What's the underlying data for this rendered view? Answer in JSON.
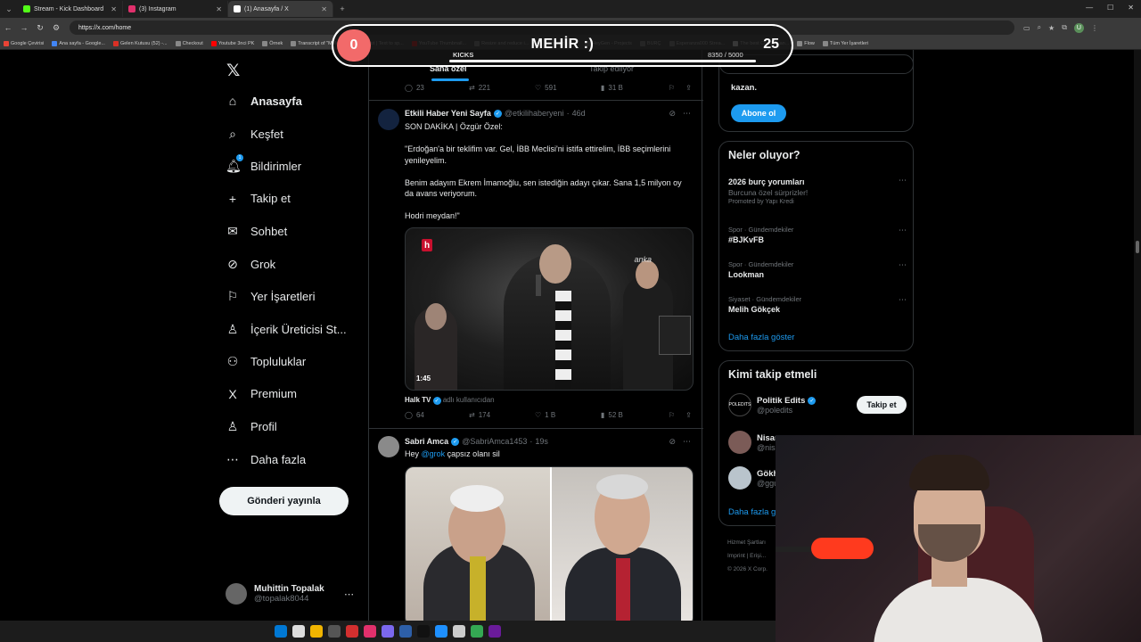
{
  "browser": {
    "tabs": [
      {
        "title": "Stream - Kick Dashboard",
        "color": "#53fc18"
      },
      {
        "title": "(3) Instagram",
        "color": "#e1306c"
      },
      {
        "title": "(1) Anasayfa / X",
        "color": "#ffffff"
      }
    ],
    "url": "https://x.com/home",
    "bookmarks": [
      "Google Çevirisi",
      "Ana sayfa - Google...",
      "Gelen Kutusu (52) -...",
      "Checkout",
      "Youtube 3nci PK",
      "Örnek",
      "Transcript of \"Mi M...",
      "CapCut | Text to sp...",
      "YouTube Thumbnail...",
      "Resize and reduce i...",
      "İspanyolca Ö...",
      "HeyGen - Projects",
      "BURÇ",
      "Esperanza000 Strea...",
      "The best ChatBot an...",
      "Flow",
      "Tüm Yer İşaretleri"
    ],
    "profile_initial": "U"
  },
  "overlay": {
    "left_value": "0",
    "title": "MEHİR :)",
    "right_value": "25",
    "kicks_label": "KICKS",
    "kicks_count": "8350",
    "kicks_goal": "/ 5000",
    "progress": 1.0
  },
  "nav": {
    "items": [
      {
        "label": "Anasayfa",
        "icon": "⌂"
      },
      {
        "label": "Keşfet",
        "icon": "⌕"
      },
      {
        "label": "Bildirimler",
        "icon": "🔔︎",
        "badge": "1"
      },
      {
        "label": "Takip et",
        "icon": "+"
      },
      {
        "label": "Sohbet",
        "icon": "✉"
      },
      {
        "label": "Grok",
        "icon": "⊘"
      },
      {
        "label": "Yer İşaretleri",
        "icon": "⚐"
      },
      {
        "label": "İçerik Üreticisi St...",
        "icon": "♙"
      },
      {
        "label": "Topluluklar",
        "icon": "⚇"
      },
      {
        "label": "Premium",
        "icon": "X"
      },
      {
        "label": "Profil",
        "icon": "♙"
      },
      {
        "label": "Daha fazla",
        "icon": "⋯"
      }
    ],
    "post_button": "Gönderi yayınla",
    "account_name": "Muhittin Topalak",
    "account_handle": "@topalak8044"
  },
  "feed": {
    "tab_foryou": "Sana özel",
    "tab_following": "Takip edilyor",
    "prev_actions": {
      "reply": "23",
      "repost": "221",
      "like": "591",
      "views": "31 B"
    },
    "tweet1": {
      "name": "Etkili Haber Yeni Sayfa",
      "handle": "@etkilihaberyeni",
      "time": "46d",
      "line1": "SON DAKİKA | Özgür Özel:",
      "line2": "\"Erdoğan'a bir teklifim var. Gel, İBB Meclisi'ni istifa ettirelim, İBB seçimlerini yenileyelim.",
      "line3": "Benim adayım Ekrem İmamoğlu, sen istediğin adayı çıkar. Sana 1,5 milyon oy da avans veriyorum.",
      "line4": "Hodri meydan!\"",
      "video_time": "1:45",
      "video_brand": "anka",
      "source_name": "Halk TV",
      "source_text": "adlı kullanıcıdan",
      "actions": {
        "reply": "64",
        "repost": "174",
        "like": "1 B",
        "views": "52 B"
      }
    },
    "tweet2": {
      "name": "Sabri Amca",
      "handle": "@SabriAmca1453",
      "time": "19s",
      "text_prefix": "Hey ",
      "mention": "@grok",
      "text_suffix": " çapsız olanı sil"
    }
  },
  "sidebar": {
    "subscribe_text": "kazan.",
    "subscribe_button": "Abone ol",
    "trends_title": "Neler oluyor?",
    "trends": [
      {
        "context": "",
        "title": "2026 burç yorumları",
        "sub": "Burcuna özel sürprizler!",
        "promo": "Promoted by Yapı Kredi"
      },
      {
        "context": "Spor · Gündemdekiler",
        "title": "#BJKvFB"
      },
      {
        "context": "Spor · Gündemdekiler",
        "title": "Lookman"
      },
      {
        "context": "Siyaset · Gündemdekiler",
        "title": "Melih Gökçek"
      }
    ],
    "show_more": "Daha fazla göster",
    "who_title": "Kimi takip etmeli",
    "who": [
      {
        "name": "Politik Edits",
        "handle": "@poledits",
        "button": "Takip et"
      },
      {
        "name": "Nisan",
        "handle": "@nisa..."
      },
      {
        "name": "Gökh...",
        "handle": "@ggu..."
      }
    ],
    "who_more": "Daha fazla g...",
    "footer1": "Hizmet Şartları",
    "footer2": "Imprint  |  Erişi...",
    "footer3": "© 2026 X Corp."
  }
}
